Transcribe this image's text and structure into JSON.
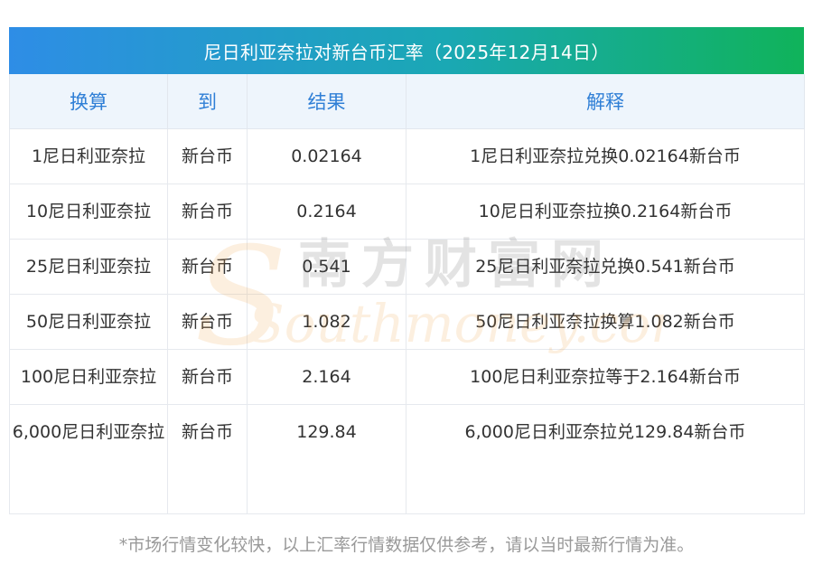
{
  "title": "尼日利亚奈拉对新台币汇率（2025年12月14日）",
  "table": {
    "headers": [
      "换算",
      "到",
      "结果",
      "解释"
    ],
    "rows": [
      {
        "amount": "1尼日利亚奈拉",
        "to": "新台币",
        "result": "0.02164",
        "explain": "1尼日利亚奈拉兑换0.02164新台币"
      },
      {
        "amount": "10尼日利亚奈拉",
        "to": "新台币",
        "result": "0.2164",
        "explain": "10尼日利亚奈拉换0.2164新台币"
      },
      {
        "amount": "25尼日利亚奈拉",
        "to": "新台币",
        "result": "0.541",
        "explain": "25尼日利亚奈拉兑换0.541新台币"
      },
      {
        "amount": "50尼日利亚奈拉",
        "to": "新台币",
        "result": "1.082",
        "explain": "50尼日利亚奈拉换算1.082新台币"
      },
      {
        "amount": "100尼日利亚奈拉",
        "to": "新台币",
        "result": "2.164",
        "explain": "100尼日利亚奈拉等于2.164新台币"
      },
      {
        "amount": "6,000尼日利亚奈拉",
        "to": "新台币",
        "result": "129.84",
        "explain": "6,000尼日利亚奈拉兑129.84新台币"
      }
    ]
  },
  "watermark": {
    "cn": "南方财富网",
    "en": "Southmoney.com",
    "color_cn": "#555555",
    "color_en": "#f0a040"
  },
  "footnote": "*市场行情变化较快，以上汇率行情数据仅供参考，请以当时最新行情为准。",
  "colors": {
    "header_text": "#2f7fd6",
    "header_bg": "#eef5fc",
    "title_gradient_start": "#2e8de6",
    "title_gradient_end": "#10b35a"
  }
}
